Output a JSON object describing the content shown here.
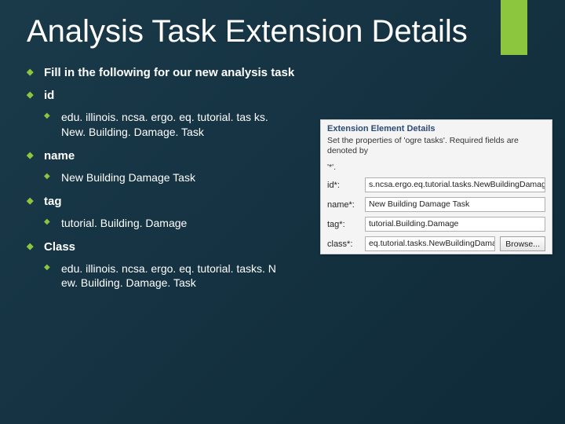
{
  "title": "Analysis Task Extension Details",
  "bullets": {
    "intro": "Fill in the following for our new analysis task",
    "id_label": "id",
    "id_value": "edu. illinois. ncsa. ergo. eq. tutorial. tas ks. New. Building. Damage. Task",
    "name_label": "name",
    "name_value": "New Building Damage Task",
    "tag_label": "tag",
    "tag_value": "tutorial. Building. Damage",
    "class_label": "Class",
    "class_value": "edu. illinois. ncsa. ergo. eq. tutorial. tasks. N ew. Building. Damage. Task"
  },
  "panel": {
    "header": "Extension Element Details",
    "desc": "Set the properties of 'ogre tasks'. Required fields are denoted by",
    "asterisk": "'*'.",
    "fields": {
      "id_label": "id*:",
      "id_value": "s.ncsa.ergo.eq.tutorial.tasks.NewBuildingDamageTask",
      "name_label": "name*:",
      "name_value": "New Building Damage Task",
      "tag_label": "tag*:",
      "tag_value": "tutorial.Building.Damage",
      "class_label": "class*:",
      "class_value": "eq.tutorial.tasks.NewBuildingDamageTask"
    },
    "browse": "Browse..."
  }
}
